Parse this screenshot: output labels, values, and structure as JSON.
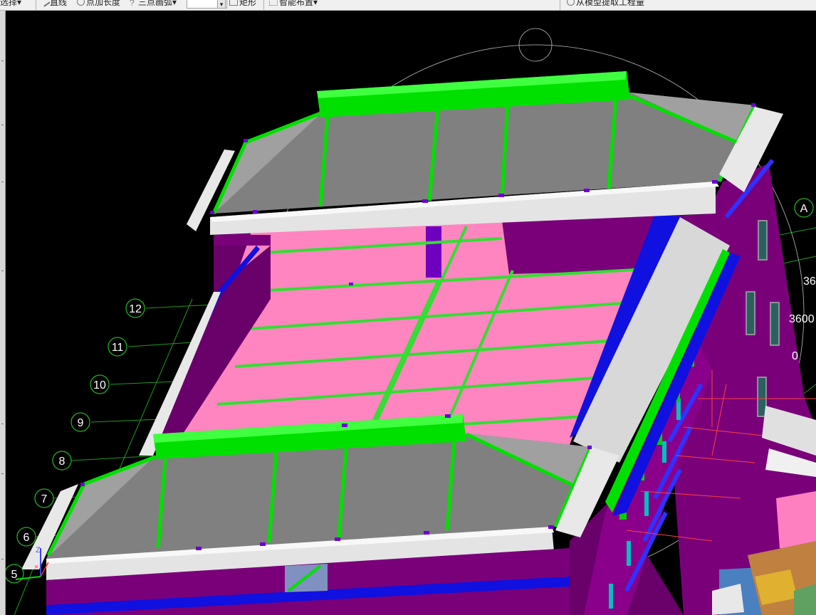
{
  "toolbar": {
    "select_label": "选择",
    "line_label": "直线",
    "point_length_label": "点加长度",
    "arc_label": "三点画弧",
    "rect_label": "矩形",
    "smart_layout_label": "智能布置",
    "extract_label": "从模型提取工程量"
  },
  "axes": {
    "row_labels": [
      "12",
      "11",
      "10",
      "9",
      "8",
      "7",
      "6",
      "5"
    ],
    "col_label": "A",
    "dimension_labels": [
      "36",
      "3600",
      "0"
    ]
  },
  "view": {
    "orbit_icon": "orbit-circle-icon",
    "axis_triad_icon": "axis-triad-icon",
    "triad_z_label": "Z"
  },
  "colors": {
    "background": "#000000",
    "wall": "#7a007a",
    "slab": "#ff85c0",
    "roof": "#808080",
    "beam": "#00e000",
    "cornice": "#e8e8e8",
    "parapet_blue": "#1010e0",
    "grid": "#22a022"
  }
}
